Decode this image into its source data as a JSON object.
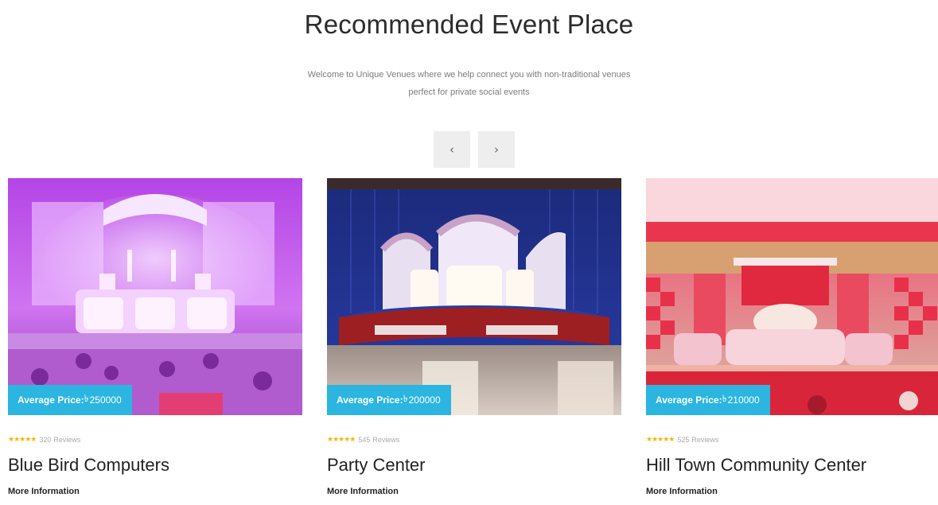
{
  "section": {
    "title": "Recommended Event Place",
    "description_line1": "Welcome to Unique Venues where we help connect you with non-traditional venues",
    "description_line2": "perfect for private social events"
  },
  "carousel": {
    "prev_label": "‹",
    "next_label": "›"
  },
  "colors": {
    "badge": "#2bb5e0",
    "star": "#f5b50a"
  },
  "venues": [
    {
      "price_label": "Average Price:",
      "currency": "৳",
      "price": "250000",
      "stars": "★★★★★",
      "reviews_count": "320",
      "reviews_label": "Reviews",
      "name": "Blue Bird Computers",
      "more_label": "More Information",
      "image_icon": "purple-wedding-stage-photo"
    },
    {
      "price_label": "Average Price:",
      "currency": "৳",
      "price": "200000",
      "stars": "★★★★★",
      "reviews_count": "545",
      "reviews_label": "Reviews",
      "name": "Party Center",
      "more_label": "More Information",
      "image_icon": "blue-stage-arch-photo"
    },
    {
      "price_label": "Average Price:",
      "currency": "৳",
      "price": "210000",
      "stars": "★★★★★",
      "reviews_count": "525",
      "reviews_label": "Reviews",
      "name": "Hill Town Community Center",
      "more_label": "More Information",
      "image_icon": "red-white-stage-photo"
    }
  ]
}
